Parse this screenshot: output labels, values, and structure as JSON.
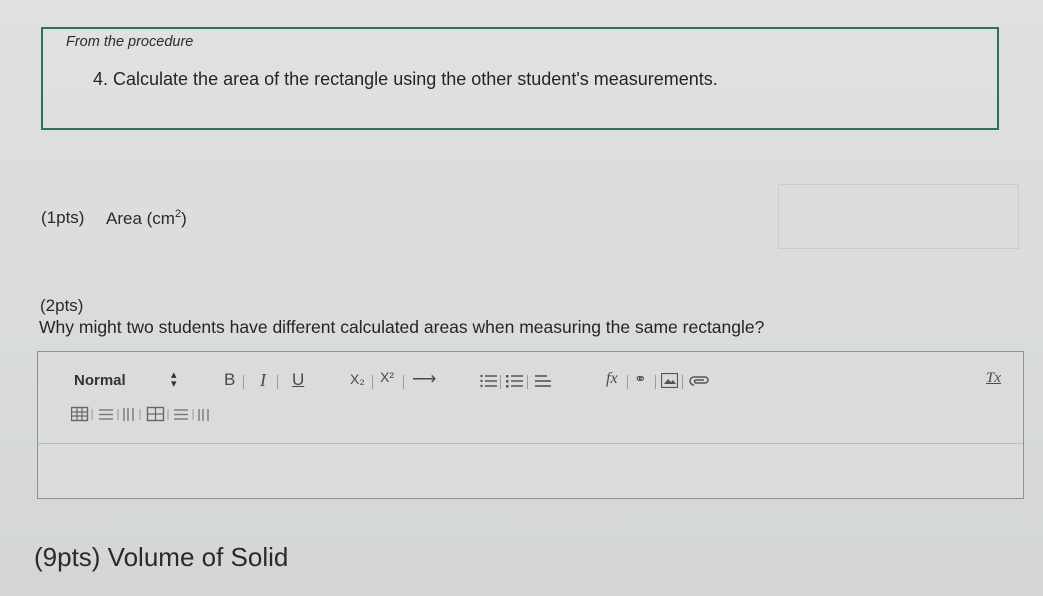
{
  "procedure": {
    "heading": "From the procedure",
    "question": "4. Calculate the area of the rectangle using the other student's measurements."
  },
  "q1": {
    "points": "(1pts)",
    "label": "Area (cm",
    "sup": "2",
    "close": ")"
  },
  "q2": {
    "points": "(2pts)",
    "question": "Why might two students have different calculated areas when measuring the same rectangle?"
  },
  "editor": {
    "format_value": "Normal",
    "bold": "B",
    "italic": "I",
    "underline": "U",
    "subscript": "X₂",
    "superscript": "X²",
    "arrow": "⟶",
    "formula": "fx",
    "clear_format": "Tx"
  },
  "q3": {
    "points": "(9pts) Volume of Solid"
  }
}
